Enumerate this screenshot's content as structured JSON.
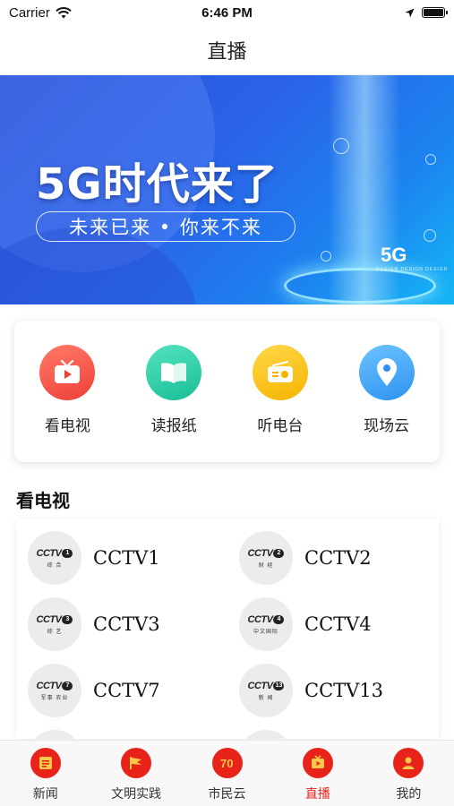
{
  "status_bar": {
    "carrier": "Carrier",
    "time": "6:46 PM"
  },
  "nav": {
    "title": "直播"
  },
  "banner": {
    "headline": "5G时代来了",
    "tagline": "未来已来 • 你来不来",
    "badge": "5G",
    "badge_sub": "DESIGN DESIGN DESIGN"
  },
  "quick_entries": [
    {
      "label": "看电视",
      "icon": "tv-icon",
      "color": "#f4574f"
    },
    {
      "label": "读报纸",
      "icon": "book-icon",
      "color": "#2ecfa8"
    },
    {
      "label": "听电台",
      "icon": "radio-icon",
      "color": "#fbc02d"
    },
    {
      "label": "现场云",
      "icon": "location-pin-icon",
      "color": "#3aa7f5"
    }
  ],
  "tv_section": {
    "title": "看电视",
    "channels": [
      {
        "name": "CCTV1",
        "logo_word": "CCTV",
        "logo_num": "1",
        "logo_sub": "综 合"
      },
      {
        "name": "CCTV2",
        "logo_word": "CCTV",
        "logo_num": "2",
        "logo_sub": "财 经"
      },
      {
        "name": "CCTV3",
        "logo_word": "CCTV",
        "logo_num": "3",
        "logo_sub": "综 艺"
      },
      {
        "name": "CCTV4",
        "logo_word": "CCTV",
        "logo_num": "4",
        "logo_sub": "中文国际"
      },
      {
        "name": "CCTV7",
        "logo_word": "CCTV",
        "logo_num": "7",
        "logo_sub": "军事 农业"
      },
      {
        "name": "CCTV13",
        "logo_word": "CCTV",
        "logo_num": "13",
        "logo_sub": "新 闻"
      }
    ]
  },
  "tab_bar": [
    {
      "label": "新闻",
      "icon": "news-icon",
      "active": false
    },
    {
      "label": "文明实践",
      "icon": "flag-icon",
      "active": false
    },
    {
      "label": "市民云",
      "icon": "cloud-badge-icon",
      "active": false
    },
    {
      "label": "直播",
      "icon": "live-tv-icon",
      "active": true
    },
    {
      "label": "我的",
      "icon": "person-icon",
      "active": false
    }
  ],
  "colors": {
    "accent": "#e8231a",
    "banner_blue": "#2a64e8"
  }
}
